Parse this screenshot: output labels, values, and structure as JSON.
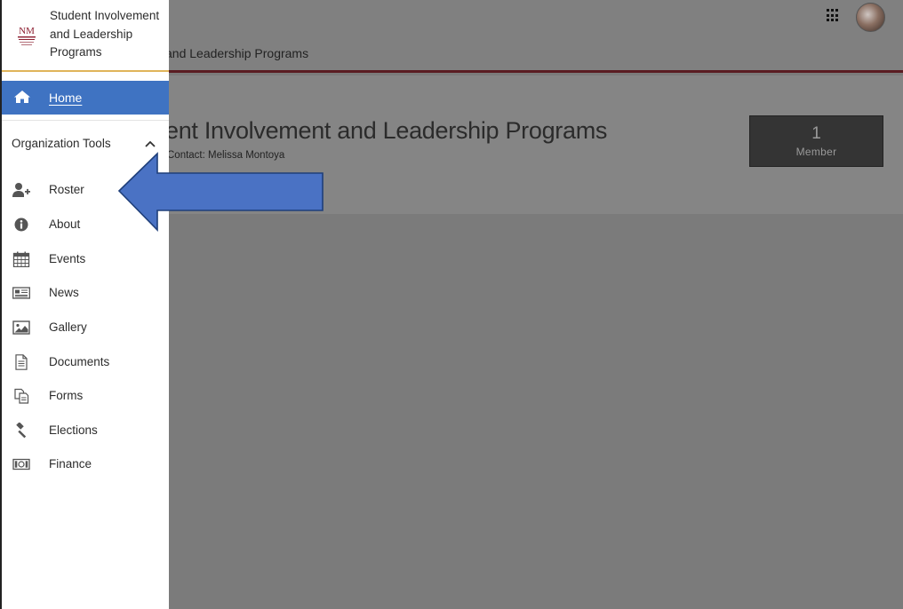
{
  "background": {
    "breadcrumb": "and Leadership Programs",
    "org_title": "ent Involvement and Leadership Programs",
    "contact": "Contact: Melissa Montoya",
    "member_count": "1",
    "member_label": "Member"
  },
  "sidebar": {
    "brand_name": "Student Involvement and Leadership Programs",
    "logo_text": "NM",
    "home_label": "Home",
    "section_title": "Organization Tools",
    "items": [
      {
        "label": "Roster",
        "icon": "add-user-icon"
      },
      {
        "label": "About",
        "icon": "info-icon"
      },
      {
        "label": "Events",
        "icon": "calendar-icon"
      },
      {
        "label": "News",
        "icon": "newspaper-icon"
      },
      {
        "label": "Gallery",
        "icon": "image-icon"
      },
      {
        "label": "Documents",
        "icon": "document-icon"
      },
      {
        "label": "Forms",
        "icon": "forms-icon"
      },
      {
        "label": "Elections",
        "icon": "gavel-icon"
      },
      {
        "label": "Finance",
        "icon": "money-icon"
      }
    ]
  },
  "colors": {
    "accent_blue": "#3f73c2",
    "brand_maroon": "#8c1d2f",
    "arrow_blue": "#4a72c4",
    "overlay_gray": "#7b7b7b"
  }
}
